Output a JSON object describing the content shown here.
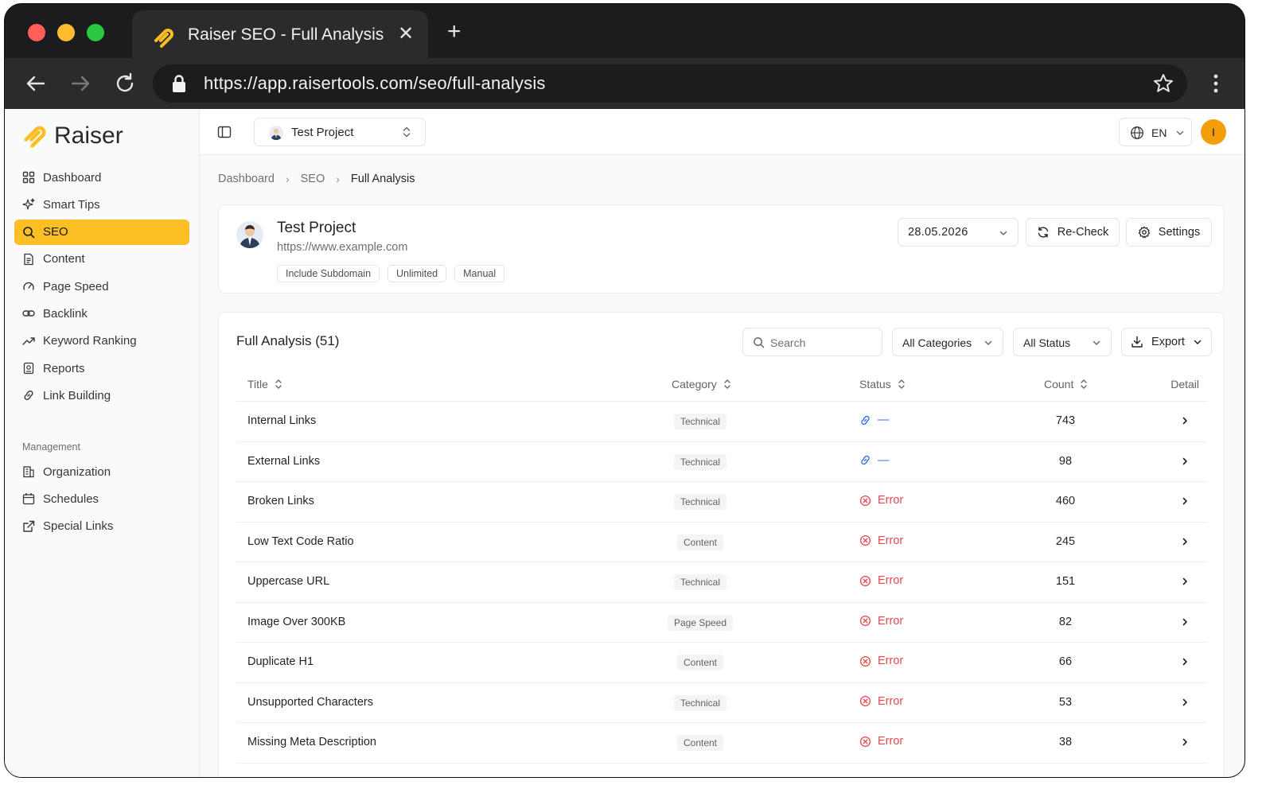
{
  "browser": {
    "tab_title": "Raiser SEO - Full Analysis",
    "url": "https://app.raisertools.com/seo/full-analysis"
  },
  "brand": {
    "name": "Raiser",
    "accent": "#fbbf24"
  },
  "sidebar": {
    "items": [
      {
        "label": "Dashboard",
        "icon": "grid-icon"
      },
      {
        "label": "Smart Tips",
        "icon": "sparkles-icon"
      },
      {
        "label": "SEO",
        "icon": "search-icon",
        "active": true
      },
      {
        "label": "Content",
        "icon": "document-icon"
      },
      {
        "label": "Page Speed",
        "icon": "gauge-icon"
      },
      {
        "label": "Backlink",
        "icon": "link-chain-icon"
      },
      {
        "label": "Keyword Ranking",
        "icon": "trend-up-icon"
      },
      {
        "label": "Reports",
        "icon": "report-icon"
      },
      {
        "label": "Link Building",
        "icon": "link-icon"
      }
    ],
    "management_label": "Management",
    "management_items": [
      {
        "label": "Organization",
        "icon": "building-icon"
      },
      {
        "label": "Schedules",
        "icon": "calendar-icon"
      },
      {
        "label": "Special Links",
        "icon": "external-link-icon"
      }
    ]
  },
  "topbar": {
    "project_select": "Test Project",
    "language": "EN",
    "user_initial": "I"
  },
  "breadcrumb": {
    "items": [
      "Dashboard",
      "SEO",
      "Full Analysis"
    ]
  },
  "project": {
    "name": "Test Project",
    "url": "https://www.example.com",
    "tags": [
      "Include Subdomain",
      "Unlimited",
      "Manual"
    ],
    "date": "28.05.2026",
    "recheck_label": "Re-Check",
    "settings_label": "Settings"
  },
  "table": {
    "title": "Full Analysis (51)",
    "search_placeholder": "Search",
    "category_filter": "All Categories",
    "status_filter": "All Status",
    "export_label": "Export",
    "columns": [
      "Title",
      "Category",
      "Status",
      "Count",
      "Detail"
    ],
    "rows": [
      {
        "title": "Internal Links",
        "category": "Technical",
        "status": "—",
        "status_type": "link",
        "count": "743"
      },
      {
        "title": "External Links",
        "category": "Technical",
        "status": "—",
        "status_type": "link",
        "count": "98"
      },
      {
        "title": "Broken Links",
        "category": "Technical",
        "status": "Error",
        "status_type": "error",
        "count": "460"
      },
      {
        "title": "Low Text Code Ratio",
        "category": "Content",
        "status": "Error",
        "status_type": "error",
        "count": "245"
      },
      {
        "title": "Uppercase URL",
        "category": "Technical",
        "status": "Error",
        "status_type": "error",
        "count": "151"
      },
      {
        "title": "Image Over 300KB",
        "category": "Page Speed",
        "status": "Error",
        "status_type": "error",
        "count": "82"
      },
      {
        "title": "Duplicate H1",
        "category": "Content",
        "status": "Error",
        "status_type": "error",
        "count": "66"
      },
      {
        "title": "Unsupported Characters",
        "category": "Technical",
        "status": "Error",
        "status_type": "error",
        "count": "53"
      },
      {
        "title": "Missing Meta Description",
        "category": "Content",
        "status": "Error",
        "status_type": "error",
        "count": "38"
      }
    ]
  },
  "colors": {
    "error": "#e5484d",
    "link": "#2f6fe4",
    "active_nav": "#fbbf24",
    "avatar": "#f59e0b"
  }
}
